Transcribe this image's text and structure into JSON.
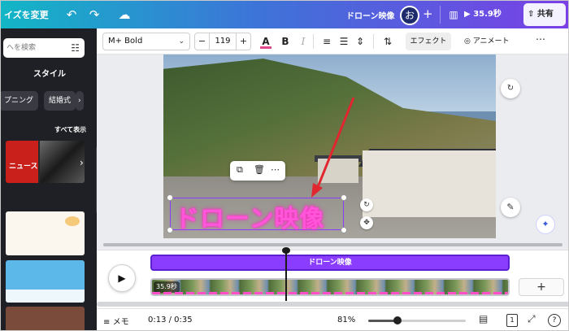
{
  "topbar": {
    "resize_label": "イズを変更",
    "title": "ドローン映像",
    "avatar_letter": "お",
    "add_label": "+",
    "present_label": "35.9秒",
    "share_label": "共有"
  },
  "sidebar": {
    "search_placeholder": "ヘを検索",
    "style_label": "スタイル",
    "chips": [
      "プニング",
      "結婚式"
    ],
    "see_all": "すべて表示",
    "thumbnail_title": "ニュース"
  },
  "toolbar": {
    "font": "M+ Bold",
    "font_size": "119",
    "effect_label": "エフェクト",
    "animate_label": "アニメート"
  },
  "canvas": {
    "caption": "ドローン映像"
  },
  "timeline": {
    "text_track_label": "ドローン映像",
    "video_duration": "35.9秒",
    "add_label": "+"
  },
  "bottombar": {
    "memo_label": "メモ",
    "time": "0:13 / 0:35",
    "zoom": "81%",
    "zoom_fraction": 0.3,
    "page_number": "1",
    "help_label": "?"
  },
  "colors": {
    "accent": "#8b3dff",
    "caption": "#ff55d8",
    "arrow": "#e0262e"
  }
}
